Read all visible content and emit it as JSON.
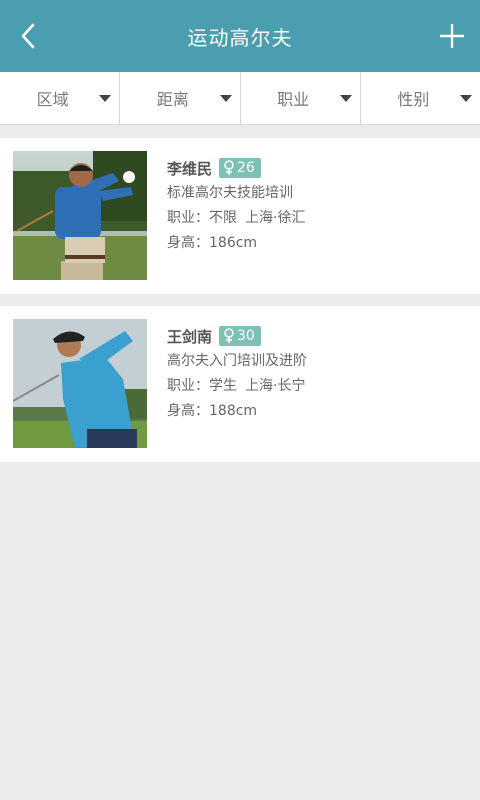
{
  "header": {
    "title": "运动高尔夫",
    "back_icon": "chevron-left-icon",
    "add_icon": "plus-icon"
  },
  "filters": [
    {
      "label": "区域"
    },
    {
      "label": "距离"
    },
    {
      "label": "职业"
    },
    {
      "label": "性别"
    }
  ],
  "coaches": [
    {
      "name": "李维民",
      "gender_icon": "female-icon",
      "age": "26",
      "course": "标准高尔夫技能培训",
      "occupation": "职业：不限",
      "location": "上海·徐汇",
      "height": "身高：186cm"
    },
    {
      "name": "王剑南",
      "gender_icon": "female-icon",
      "age": "30",
      "course": "高尔夫入门培训及进阶",
      "occupation": "职业：学生",
      "location": "上海·长宁",
      "height": "身高：188cm"
    }
  ],
  "colors": {
    "header_bg": "#4a9eb0",
    "badge_bg": "#7cc0b6",
    "page_bg": "#ebebeb"
  }
}
